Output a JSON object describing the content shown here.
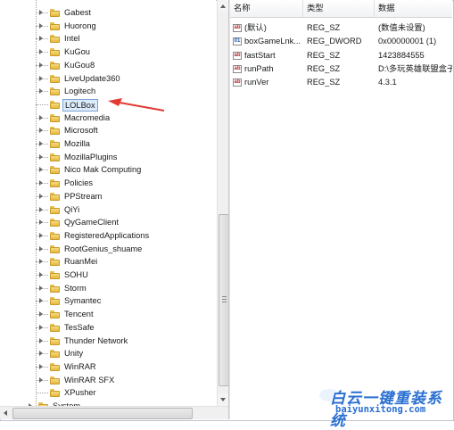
{
  "tree": {
    "items": [
      {
        "label": "Gabest"
      },
      {
        "label": "Huorong"
      },
      {
        "label": "Intel"
      },
      {
        "label": "KuGou"
      },
      {
        "label": "KuGou8"
      },
      {
        "label": "LiveUpdate360"
      },
      {
        "label": "Logitech"
      },
      {
        "label": "LOLBox"
      },
      {
        "label": "Macromedia"
      },
      {
        "label": "Microsoft"
      },
      {
        "label": "Mozilla"
      },
      {
        "label": "MozillaPlugins"
      },
      {
        "label": "Nico Mak Computing"
      },
      {
        "label": "Policies"
      },
      {
        "label": "PPStream"
      },
      {
        "label": "QiYi"
      },
      {
        "label": "QyGameClient"
      },
      {
        "label": "RegisteredApplications"
      },
      {
        "label": "RootGenius_shuame"
      },
      {
        "label": "RuanMei"
      },
      {
        "label": "SOHU"
      },
      {
        "label": "Storm"
      },
      {
        "label": "Symantec"
      },
      {
        "label": "Tencent"
      },
      {
        "label": "TesSafe"
      },
      {
        "label": "Thunder Network"
      },
      {
        "label": "Unity"
      },
      {
        "label": "WinRAR"
      },
      {
        "label": "WinRAR SFX"
      },
      {
        "label": "XPusher"
      }
    ],
    "selected": "LOLBox",
    "system": {
      "label": "System"
    }
  },
  "list": {
    "columns": {
      "name": "名称",
      "type": "类型",
      "data": "数据"
    },
    "rows": [
      {
        "name": "(默认)",
        "type": "REG_SZ",
        "data": "(数值未设置)",
        "icon": "string-value-icon"
      },
      {
        "name": "boxGameLnk...",
        "type": "REG_DWORD",
        "data": "0x00000001 (1)",
        "icon": "binary-value-icon"
      },
      {
        "name": "fastStart",
        "type": "REG_SZ",
        "data": "1423884555",
        "icon": "string-value-icon"
      },
      {
        "name": "runPath",
        "type": "REG_SZ",
        "data": "D:\\多玩英雄联盟盒子",
        "icon": "string-value-icon"
      },
      {
        "name": "runVer",
        "type": "REG_SZ",
        "data": "4.3.1",
        "icon": "string-value-icon"
      }
    ]
  },
  "watermark": {
    "cn": "白云一键重装系统",
    "url": "baiyunxitong.com"
  },
  "colors": {
    "selection_bg": "#dcebfc",
    "selection_border": "#7da2ce",
    "arrow": "#e23a34",
    "folder": "#f0cc5e",
    "watermark": "#2a6fd2"
  }
}
